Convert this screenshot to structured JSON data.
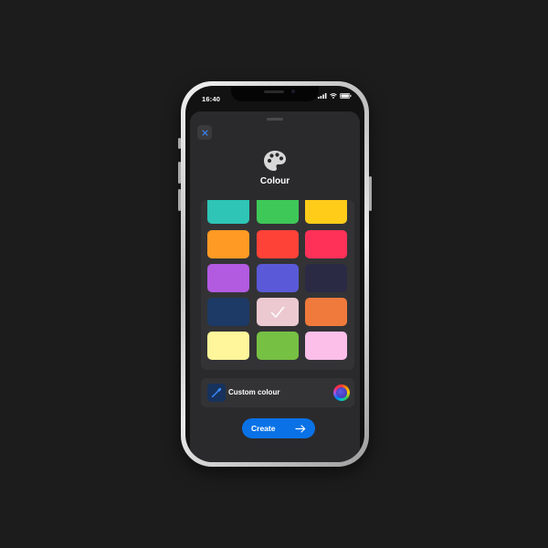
{
  "status_bar": {
    "time": "16:40",
    "icons": [
      "signal-icon",
      "wifi-icon",
      "battery-icon"
    ]
  },
  "sheet": {
    "title": "Colour",
    "close_icon": "close-icon",
    "header_icon": "palette-icon"
  },
  "swatches": [
    {
      "name": "teal",
      "color": "#2ec4b6",
      "selected": false
    },
    {
      "name": "green",
      "color": "#3ec858",
      "selected": false
    },
    {
      "name": "yellow",
      "color": "#ffcc1a",
      "selected": false
    },
    {
      "name": "orange",
      "color": "#ff9a24",
      "selected": false
    },
    {
      "name": "red",
      "color": "#ff4238",
      "selected": false
    },
    {
      "name": "pink-red",
      "color": "#ff3158",
      "selected": false
    },
    {
      "name": "purple",
      "color": "#b25ae0",
      "selected": false
    },
    {
      "name": "indigo",
      "color": "#5a5ad8",
      "selected": false
    },
    {
      "name": "dark-navy",
      "color": "#2b2a45",
      "selected": false
    },
    {
      "name": "navy",
      "color": "#1d3a66",
      "selected": false
    },
    {
      "name": "light-pink",
      "color": "#ecc9d0",
      "selected": true
    },
    {
      "name": "burnt-orange",
      "color": "#f07a3c",
      "selected": false
    },
    {
      "name": "pale-yellow",
      "color": "#fff59a",
      "selected": false
    },
    {
      "name": "lime-green",
      "color": "#76c043",
      "selected": false
    },
    {
      "name": "light-magenta",
      "color": "#fcbfe9",
      "selected": false
    }
  ],
  "custom": {
    "label": "Custom colour",
    "icon": "eyedropper-icon",
    "picker_icon": "color-wheel-icon"
  },
  "actions": {
    "create_label": "Create",
    "create_icon": "arrow-right-icon",
    "accent": "#0a72e6"
  }
}
